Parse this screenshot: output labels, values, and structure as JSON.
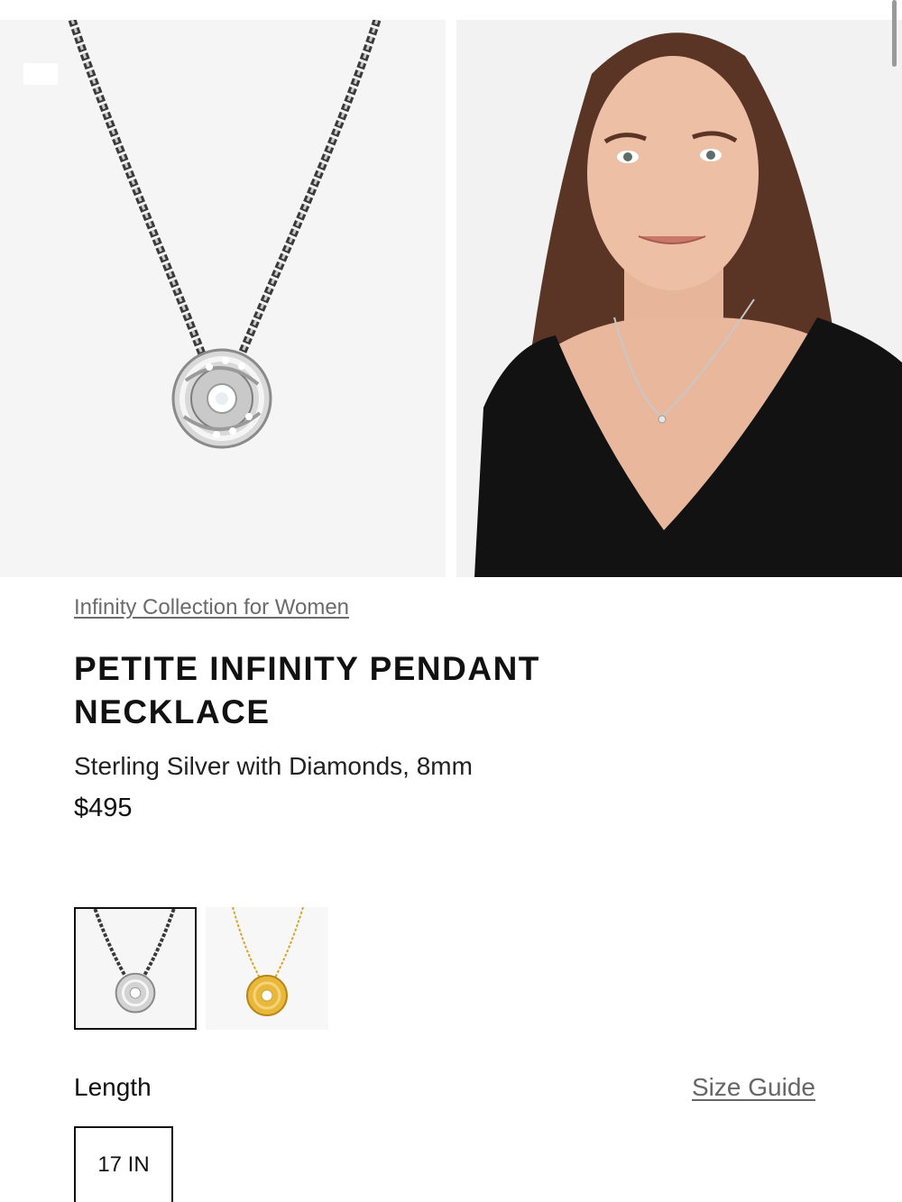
{
  "product": {
    "breadcrumb": "Infinity Collection for Women",
    "title": "PETITE INFINITY PENDANT NECKLACE",
    "subtitle": "Sterling Silver with Diamonds, 8mm",
    "price": "$495"
  },
  "gallery": {
    "images": [
      {
        "name": "silver-pendant-product-image"
      },
      {
        "name": "model-wearing-necklace-image"
      }
    ]
  },
  "variants": [
    {
      "name": "sterling-silver",
      "color": "#b9b9b9",
      "selected": true
    },
    {
      "name": "yellow-gold",
      "color": "#d9a42a",
      "selected": false
    }
  ],
  "length": {
    "label": "Length",
    "size_guide": "Size Guide",
    "options": [
      "17 IN"
    ]
  },
  "colors": {
    "text": "#111111",
    "muted": "#6b6b6b",
    "silver": "#b9b9b9",
    "gold": "#d9a42a"
  }
}
